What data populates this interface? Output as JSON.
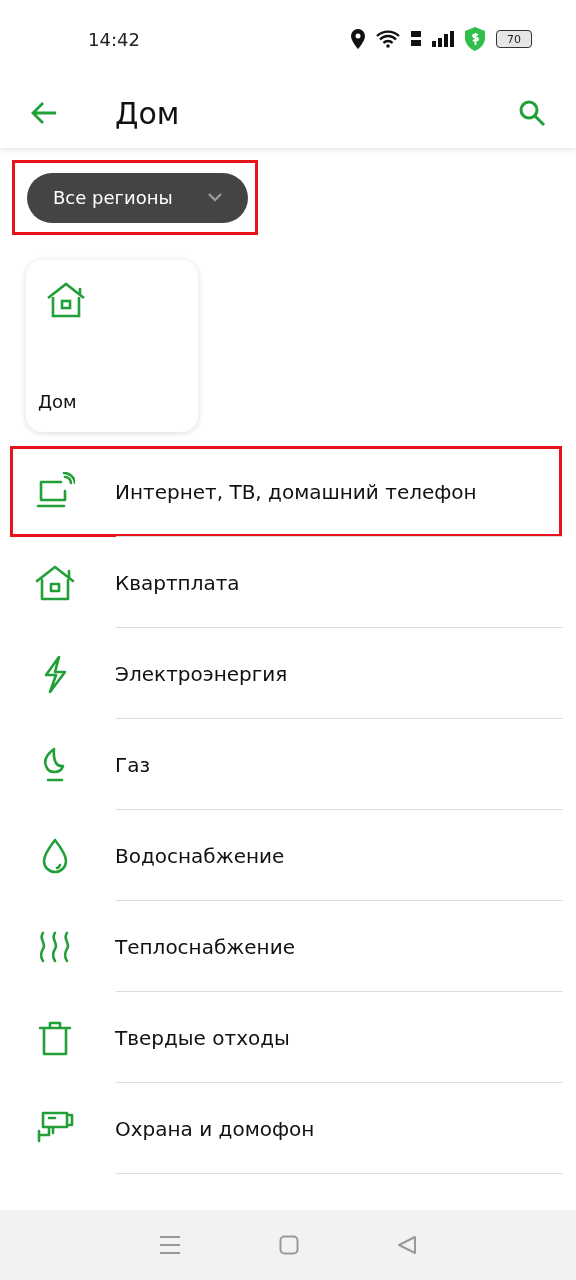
{
  "status_bar": {
    "time": "14:42",
    "battery": "70"
  },
  "app_bar": {
    "title": "Дом"
  },
  "filter": {
    "label": "Все регионы",
    "highlighted": true
  },
  "cards": [
    {
      "label": "Дом",
      "kind": "house"
    }
  ],
  "items": [
    {
      "label": "Интернет, ТВ, домашний телефон",
      "kind": "laptop",
      "highlighted": true
    },
    {
      "label": "Квартплата",
      "kind": "house",
      "highlighted": false
    },
    {
      "label": "Электроэнергия",
      "kind": "bolt",
      "highlighted": false
    },
    {
      "label": "Газ",
      "kind": "flame",
      "highlighted": false
    },
    {
      "label": "Водоснабжение",
      "kind": "drop",
      "highlighted": false
    },
    {
      "label": "Теплоснабжение",
      "kind": "heat",
      "highlighted": false
    },
    {
      "label": "Твердые отходы",
      "kind": "trash",
      "highlighted": false
    },
    {
      "label": "Охрана и домофон",
      "kind": "camera",
      "highlighted": false
    }
  ]
}
